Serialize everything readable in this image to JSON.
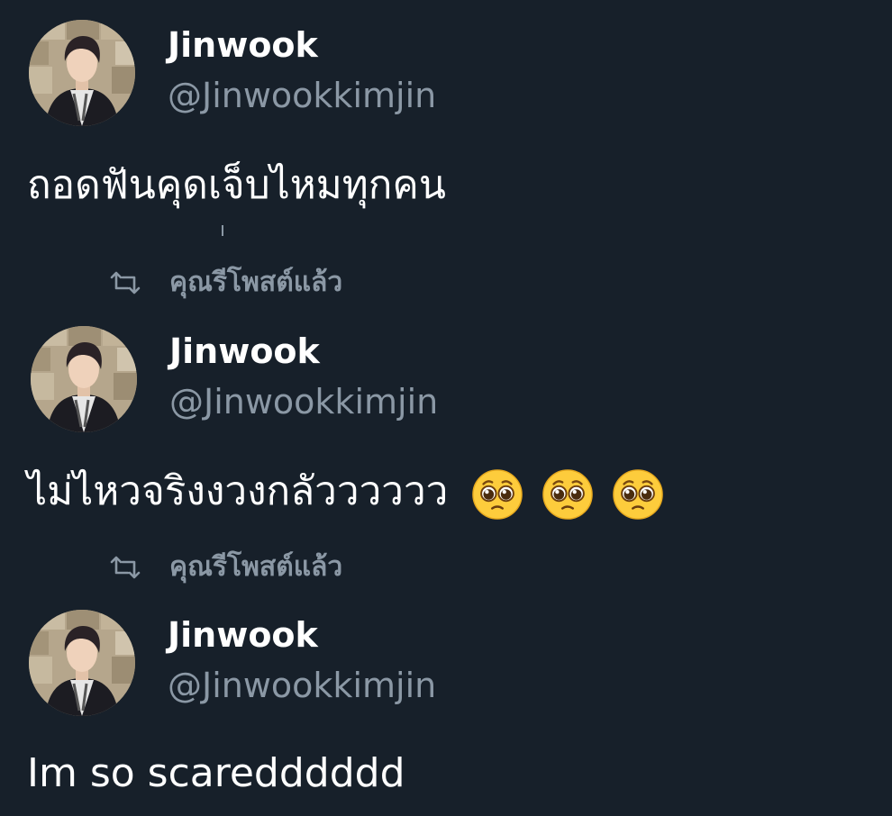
{
  "colors": {
    "background": "#17202a",
    "primary_text": "#ffffff",
    "secondary_text": "#8b98a5"
  },
  "tweets": [
    {
      "display_name": "Jinwook",
      "handle": "@Jinwookkimjin",
      "text": "ถอดฟันคุดเจ็บไหมทุกคน",
      "emojis": []
    },
    {
      "display_name": "Jinwook",
      "handle": "@Jinwookkimjin",
      "text": "ไม่ไหวจริงงวงกลัวววววว",
      "emojis": [
        "pleading-face",
        "pleading-face",
        "pleading-face"
      ]
    },
    {
      "display_name": "Jinwook",
      "handle": "@Jinwookkimjin",
      "text": "Im so scaredddddd",
      "emojis": []
    }
  ],
  "retweet_labels": [
    {
      "icon": "retweet-icon",
      "label": "คุณรีโพสต์แล้ว"
    },
    {
      "icon": "retweet-icon",
      "label": "คุณรีโพสต์แล้ว"
    }
  ]
}
